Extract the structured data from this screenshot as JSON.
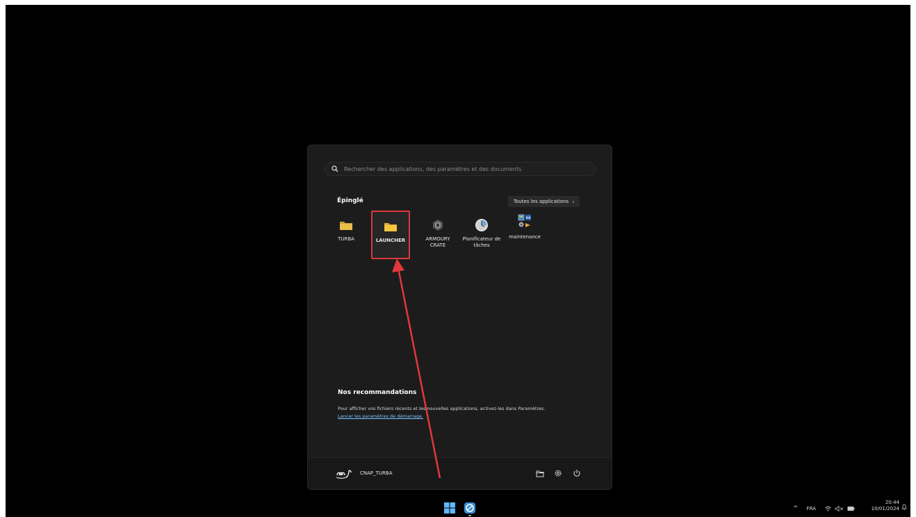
{
  "search": {
    "placeholder": "Rechercher des applications, des paramètres et des documents"
  },
  "pinned": {
    "title": "Épinglé",
    "all_apps_label": "Toutes les applications",
    "all_apps_chevron": "›",
    "apps": [
      {
        "label": "TURBA",
        "icon": "folder-icon"
      },
      {
        "label": "LAUNCHER",
        "icon": "folder-icon",
        "selected": true
      },
      {
        "label": "ARMOURY CRATE",
        "icon": "armoury-crate-icon"
      },
      {
        "label": "Planificateur de tâches",
        "icon": "clock-icon"
      },
      {
        "label": "maintenance",
        "icon": "maintenance-icon"
      }
    ]
  },
  "recommendations": {
    "title": "Nos recommandations",
    "text": "Pour afficher vos fichiers récents et les nouvelles applications, activez-les dans Paramètres.",
    "link": "Lancer les paramètres de démarrage."
  },
  "footer": {
    "user_name": "CNAP_TURBA"
  },
  "tray": {
    "chevron": "^",
    "lang": "FRA",
    "time": "20:44",
    "date": "10/01/2024"
  },
  "colors": {
    "accent_red": "#e0383c",
    "folder_yellow": "#f5c542",
    "link_blue": "#7cc4ff"
  }
}
